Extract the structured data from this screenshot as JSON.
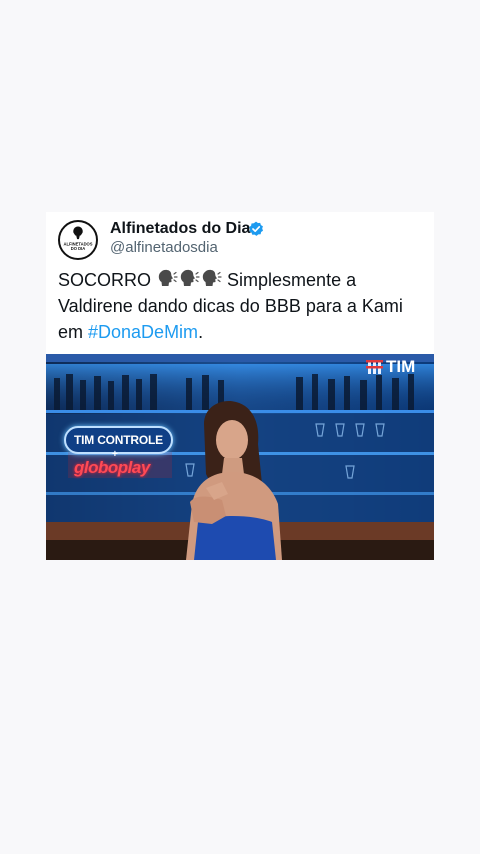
{
  "tweet": {
    "author_name": "Alfinetados do Dia",
    "author_handle": "@alfinetadosdia",
    "avatar_text_line1": "ALFINETADOS",
    "avatar_text_line2": "DO DIA",
    "text_before": "SOCORRO",
    "text_middle": " Simplesmente a Valdirene dando dicas do BBB para a Kami em ",
    "hashtag": "#DonaDeMim",
    "text_after": ".",
    "emoji_icon": "speaking-head-icon",
    "emoji_count": 3,
    "verified_color": "#1d9bf0",
    "hashtag_color": "#1d9bf0"
  },
  "media": {
    "brand": "TIM",
    "badge_label": "TIM CONTROLE",
    "plus_sign": "+",
    "partner_label": "globoplay"
  }
}
